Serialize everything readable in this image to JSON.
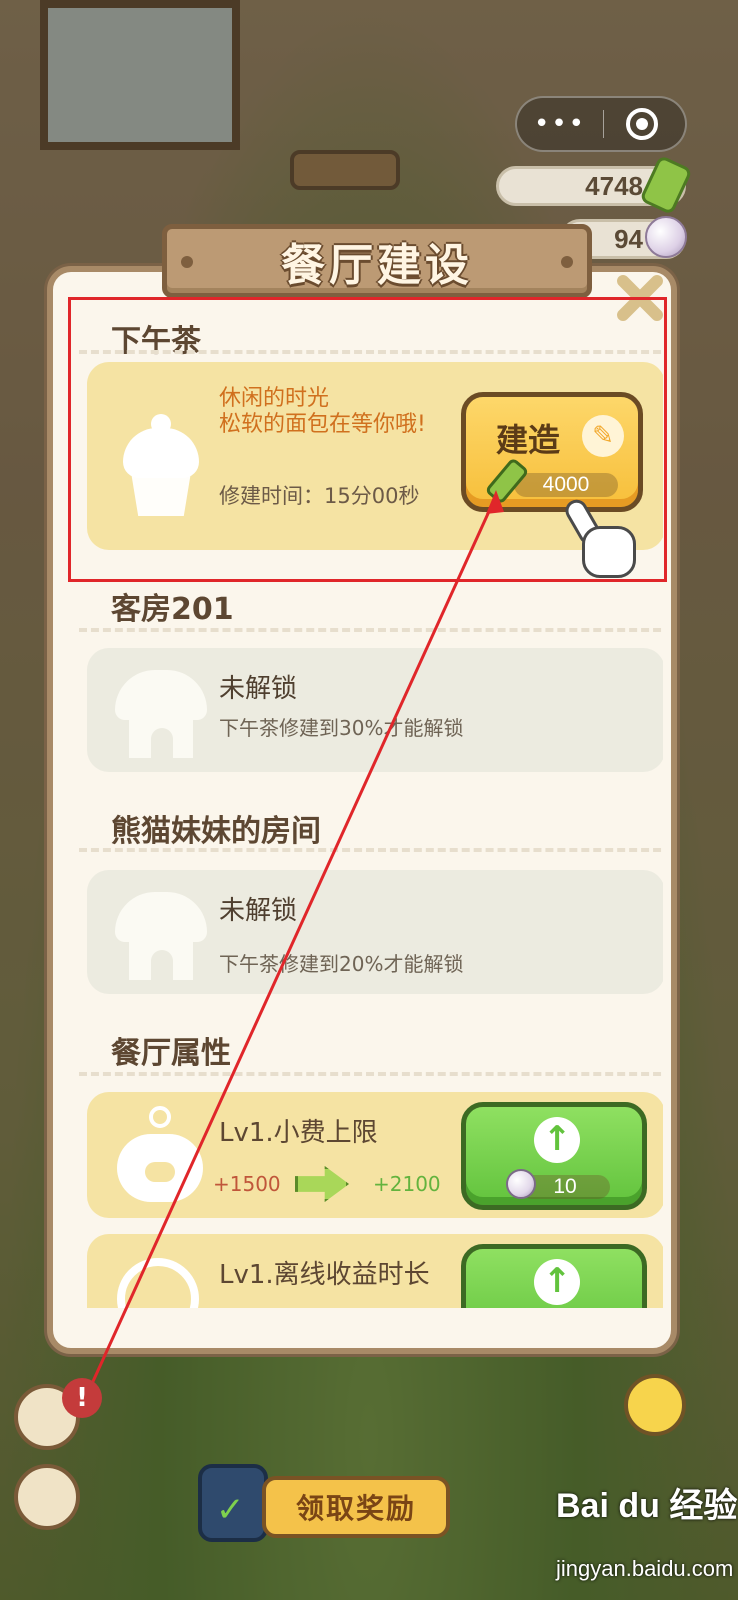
{
  "hud": {
    "menu_dots": "•••",
    "currency_bamboo": "4748",
    "currency_pearl": "94"
  },
  "dialog": {
    "title": "餐厅建设"
  },
  "sections": {
    "afternoon_tea": {
      "title": "下午茶",
      "desc_line1": "休闲的时光",
      "desc_line2": "松软的面包在等你哦!",
      "build_time": "修建时间：15分00秒",
      "build_label": "建造",
      "build_cost": "4000"
    },
    "room201": {
      "title": "客房201",
      "status": "未解锁",
      "requirement": "下午茶修建到30%才能解锁"
    },
    "panda_room": {
      "title": "熊猫妹妹的房间",
      "status": "未解锁",
      "requirement": "下午茶修建到20%才能解锁"
    },
    "attributes": {
      "title": "餐厅属性",
      "items": [
        {
          "name": "Lv1.小费上限",
          "old": "+1500",
          "new": "+2100",
          "cost": "10"
        },
        {
          "name": "Lv1.离线收益时长"
        }
      ]
    }
  },
  "bottom": {
    "alert": "!",
    "reward_label": "领取奖励",
    "watermark": "Bai du 经验",
    "watermark_url": "jingyan.baidu.com"
  },
  "icons": {
    "hammer": "hammer-icon",
    "upgrade": "up-arrow-icon"
  },
  "colors": {
    "build_button": "#f7bf3a",
    "upgrade_button": "#62c33d",
    "annotation": "#e0262a"
  }
}
